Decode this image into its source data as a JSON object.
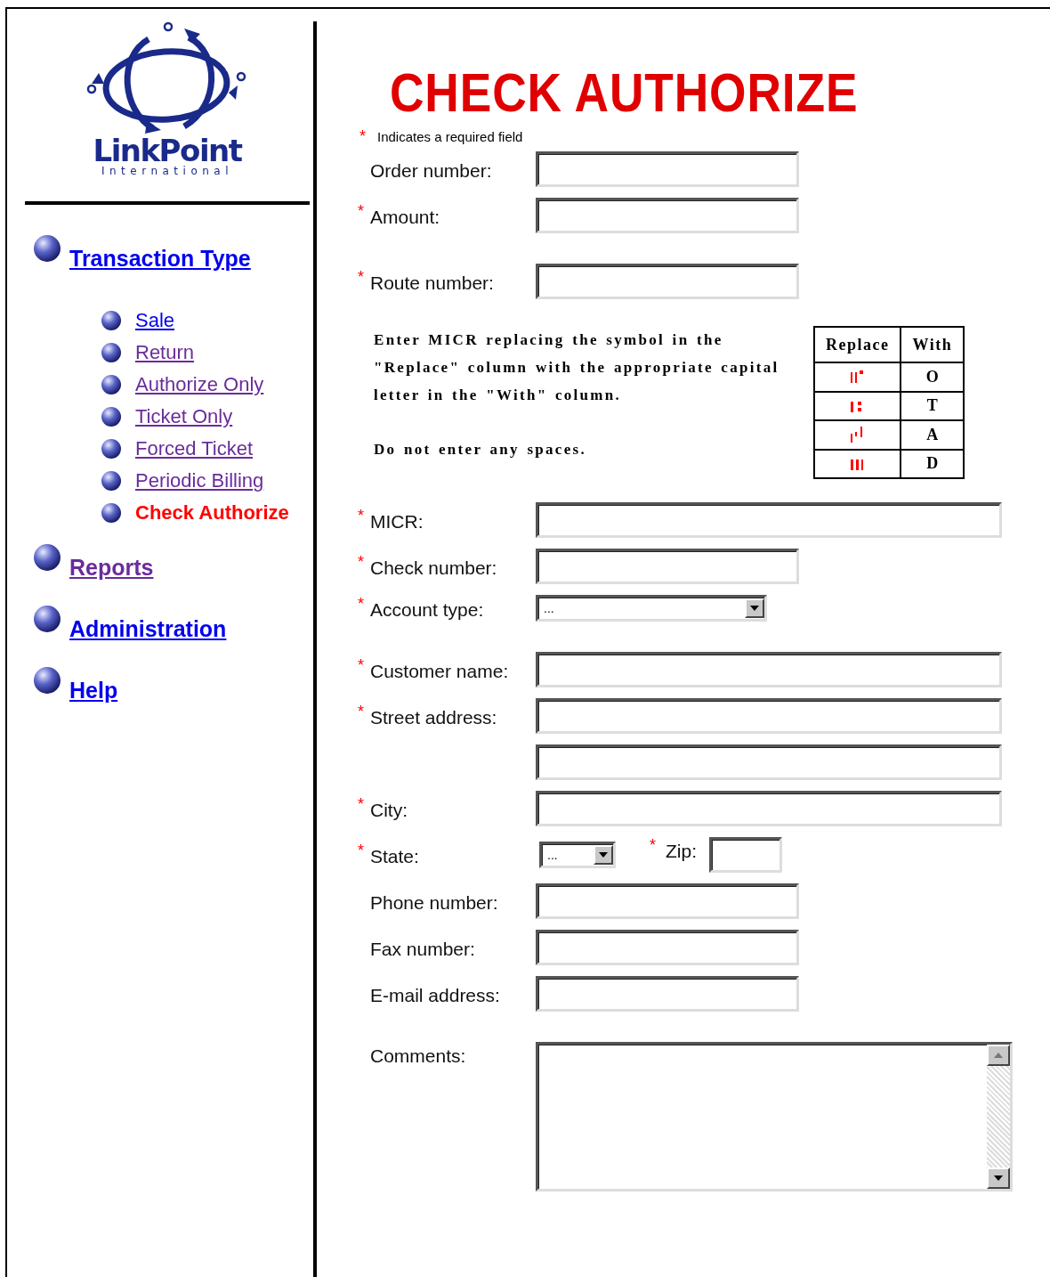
{
  "logo": {
    "name": "LinkPoint",
    "tagline": "International"
  },
  "nav": [
    {
      "label": "Transaction Type",
      "visited": false,
      "children": [
        {
          "label": "Sale",
          "visited": false,
          "selected": false
        },
        {
          "label": "Return",
          "visited": true,
          "selected": false
        },
        {
          "label": "Authorize Only",
          "visited": true,
          "selected": false
        },
        {
          "label": "Ticket Only",
          "visited": true,
          "selected": false
        },
        {
          "label": "Forced Ticket",
          "visited": true,
          "selected": false
        },
        {
          "label": "Periodic Billing",
          "visited": true,
          "selected": false
        },
        {
          "label": "Check Authorize",
          "selected": true
        }
      ]
    },
    {
      "label": "Reports",
      "visited": true
    },
    {
      "label": "Administration",
      "visited": false
    },
    {
      "label": "Help",
      "visited": false
    }
  ],
  "title": "CHECK AUTHORIZE",
  "required_note": {
    "mark": "*",
    "text": "Indicates a required field"
  },
  "sections": [
    {
      "kind": "fields",
      "fields": [
        {
          "kind": "text",
          "label": "Order number:"
        },
        {
          "kind": "text",
          "label": "Amount:",
          "mark": "*"
        }
      ]
    },
    {
      "kind": "fields",
      "fields": [
        {
          "kind": "text",
          "label": "Route number:",
          "mark": "*"
        }
      ]
    },
    {
      "kind": "instructions",
      "paragraphs": [
        "Enter MICR replacing the symbol in the \"Replace\" column with the appropriate capital letter in the \"With\" column.",
        "Do not enter any spaces."
      ],
      "table": {
        "columns": [
          "Replace",
          "With"
        ],
        "rows": [
          {
            "kind": "on-us",
            "with": "O"
          },
          {
            "kind": "transit",
            "with": "T"
          },
          {
            "kind": "amount",
            "with": "A"
          },
          {
            "kind": "dash",
            "with": "D"
          }
        ]
      }
    },
    {
      "kind": "fields",
      "fields": [
        {
          "kind": "wide-text",
          "label": "MICR:",
          "mark": "*"
        },
        {
          "kind": "text",
          "label": "Check number:",
          "mark": "*"
        },
        {
          "kind": "select",
          "label": "Account type:",
          "mark": "*",
          "value": "..."
        }
      ]
    },
    {
      "kind": "fields",
      "fields": [
        {
          "kind": "wide-text",
          "label": "Customer name:",
          "mark": "*"
        },
        {
          "kind": "wide-text",
          "label": "Street address:",
          "mark": "*"
        },
        {
          "kind": "wide-text"
        },
        {
          "kind": "wide-text",
          "label": "City:",
          "mark": "*"
        },
        {
          "kind": "state-zip",
          "label": "State:",
          "mark": "*",
          "value": "...",
          "zip": {
            "label": "Zip:",
            "mark": "*"
          }
        },
        {
          "kind": "text",
          "label": "Phone number:"
        },
        {
          "kind": "text",
          "label": "Fax number:"
        },
        {
          "kind": "text",
          "label": "E-mail address:"
        }
      ]
    },
    {
      "kind": "fields",
      "fields": [
        {
          "kind": "textarea",
          "label": "Comments:"
        }
      ]
    }
  ]
}
